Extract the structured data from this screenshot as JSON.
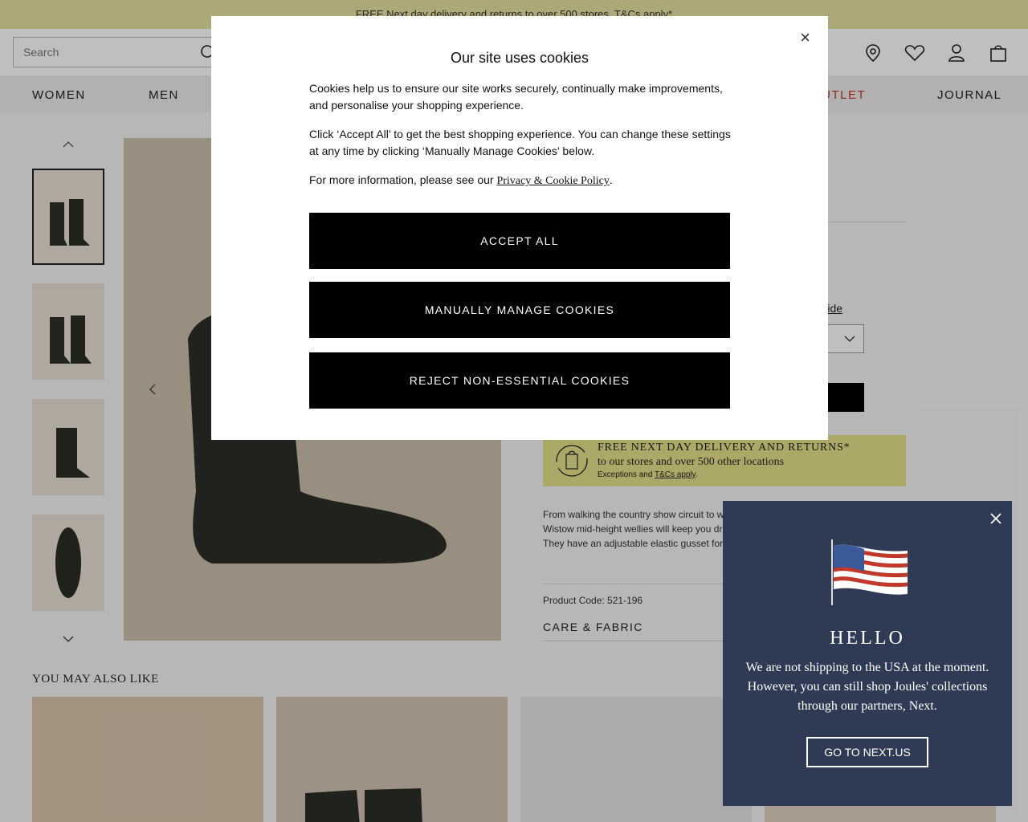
{
  "promo": {
    "text": "FREE Next day delivery and returns to over 500 stores. T&Cs apply*"
  },
  "header": {
    "search_placeholder": "Search",
    "icons": [
      "search-icon",
      "location-icon",
      "heart-icon",
      "user-icon",
      "bag-icon"
    ]
  },
  "nav": {
    "items": [
      {
        "label": "WOMEN"
      },
      {
        "label": "MEN"
      },
      {
        "label": "OUTLET"
      },
      {
        "label": "JOURNAL"
      }
    ]
  },
  "product": {
    "size_guide": "e Guide",
    "delivery": {
      "line1": "FREE NEXT DAY DELIVERY AND RETURNS*",
      "line2": "to our stores and over 500 other locations",
      "line3_prefix": "Exceptions and ",
      "line3_link": "T&Cs apply",
      "line3_suffix": "."
    },
    "description": [
      "From walking the country show circuit to w",
      "Wistow mid-height wellies will keep you dr",
      "They have an adjustable elastic gusset for"
    ],
    "product_code": "Product Code: 521-196",
    "care_label": "CARE & FABRIC"
  },
  "recommendations": {
    "title": "YOU MAY ALSO LIKE"
  },
  "cookie_modal": {
    "close": "×",
    "title": "Our site uses cookies",
    "p1": "Cookies help us to ensure our site works securely, continually make improvements, and personalise your shopping experience.",
    "p2": "Click ‘Accept All’ to get the best shopping experience. You can change these settings at any time by clicking ‘Manually Manage Cookies’ below.",
    "p3_prefix": "For more information, please see our ",
    "p3_link": "Privacy & Cookie Policy",
    "p3_suffix": ".",
    "accept_all": "ACCEPT ALL",
    "manually_manage": "MANUALLY MANAGE COOKIES",
    "reject": "REJECT NON-ESSENTIAL COOKIES"
  },
  "region_popup": {
    "title": "HELLO",
    "text": "We are not shipping to the USA at the moment. However, you can still shop Joules' collections through our partners, Next.",
    "button": "GO TO NEXT.US"
  }
}
